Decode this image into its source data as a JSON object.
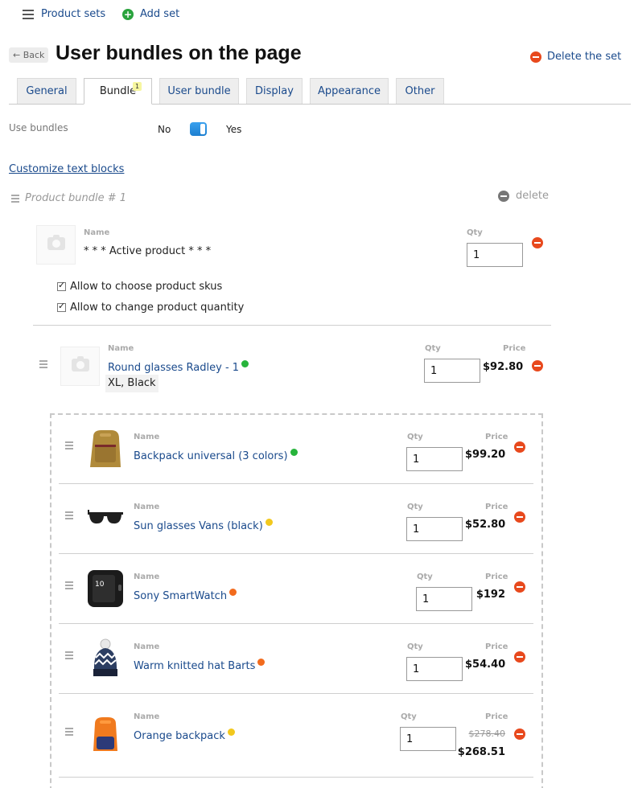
{
  "toolbar": {
    "product_sets": "Product sets",
    "add_set": "Add set"
  },
  "header": {
    "back": "Back",
    "title": "User bundles on the page",
    "delete_set": "Delete the set"
  },
  "tabs": [
    {
      "label": "General"
    },
    {
      "label": "Bundle",
      "badge": "1",
      "active": true
    },
    {
      "label": "User bundle"
    },
    {
      "label": "Display"
    },
    {
      "label": "Appearance"
    },
    {
      "label": "Other"
    }
  ],
  "settings": {
    "use_bundles_label": "Use bundles",
    "no": "No",
    "yes": "Yes",
    "use_bundles_on": true,
    "customize_link": "Customize text blocks"
  },
  "bundle": {
    "title": "Product bundle # 1",
    "delete_label": "delete",
    "active": {
      "name_header": "Name",
      "qty_header": "Qty",
      "name": "* * * Active product * * *",
      "qty": "1"
    },
    "options": [
      {
        "label": "Allow to choose product skus",
        "checked": true
      },
      {
        "label": "Allow to change product quantity",
        "checked": true
      }
    ],
    "main_item": {
      "name_header": "Name",
      "qty_header": "Qty",
      "price_header": "Price",
      "name": "Round glasses Radley - 1",
      "status": "green",
      "sku": "XL, Black",
      "qty": "1",
      "price": "$92.80"
    },
    "items": [
      {
        "name": "Backpack universal (3 colors)",
        "status": "green",
        "image": "backpack-icon",
        "qty": "1",
        "price": "$99.20"
      },
      {
        "name": "Sun glasses Vans (black)",
        "status": "yellow",
        "image": "sunglasses-icon",
        "qty": "1",
        "price": "$52.80"
      },
      {
        "name": "Sony SmartWatch",
        "status": "orange",
        "image": "smartwatch-icon",
        "qty": "1",
        "price": "$192"
      },
      {
        "name": "Warm knitted hat Barts",
        "status": "orange",
        "image": "knitted-hat-icon",
        "qty": "1",
        "price": "$54.40"
      },
      {
        "name": "Orange backpack",
        "status": "yellow",
        "image": "orange-backpack-icon",
        "qty": "1",
        "old_price": "$278.40",
        "price": "$268.51"
      }
    ],
    "item_headers": {
      "name": "Name",
      "qty": "Qty",
      "price": "Price"
    }
  },
  "colors": {
    "link": "#1a4a8c",
    "remove": "#e8491d",
    "ok": "#27b43b",
    "warn": "#f2c81d",
    "alert": "#f26b1d"
  }
}
